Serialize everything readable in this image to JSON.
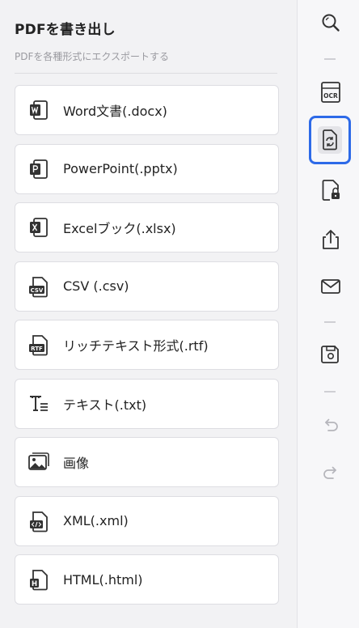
{
  "panel": {
    "title": "PDFを書き出し",
    "subtitle": "PDFを各種形式にエクスポートする"
  },
  "formats": [
    {
      "label": "Word文書(.docx)",
      "icon": "word-icon"
    },
    {
      "label": "PowerPoint(.pptx)",
      "icon": "powerpoint-icon"
    },
    {
      "label": "Excelブック(.xlsx)",
      "icon": "excel-icon"
    },
    {
      "label": "CSV (.csv)",
      "icon": "csv-icon"
    },
    {
      "label": "リッチテキスト形式(.rtf)",
      "icon": "rtf-icon"
    },
    {
      "label": "テキスト(.txt)",
      "icon": "text-icon"
    },
    {
      "label": "画像",
      "icon": "image-icon"
    },
    {
      "label": "XML(.xml)",
      "icon": "xml-icon"
    },
    {
      "label": "HTML(.html)",
      "icon": "html-icon"
    }
  ],
  "toolbar": {
    "ocr_label": "OCR",
    "tools": [
      "search-icon",
      "ocr-icon",
      "convert-icon",
      "protect-icon",
      "share-icon",
      "mail-icon",
      "save-icon",
      "undo-icon",
      "redo-icon"
    ],
    "active_tool": "convert-icon"
  },
  "icon_labels": {
    "csv": "CSV",
    "rtf": "RTF",
    "html": "H"
  },
  "colors": {
    "accent": "#2d6ae8",
    "icon": "#333333",
    "disabled": "#b5b5bb"
  }
}
